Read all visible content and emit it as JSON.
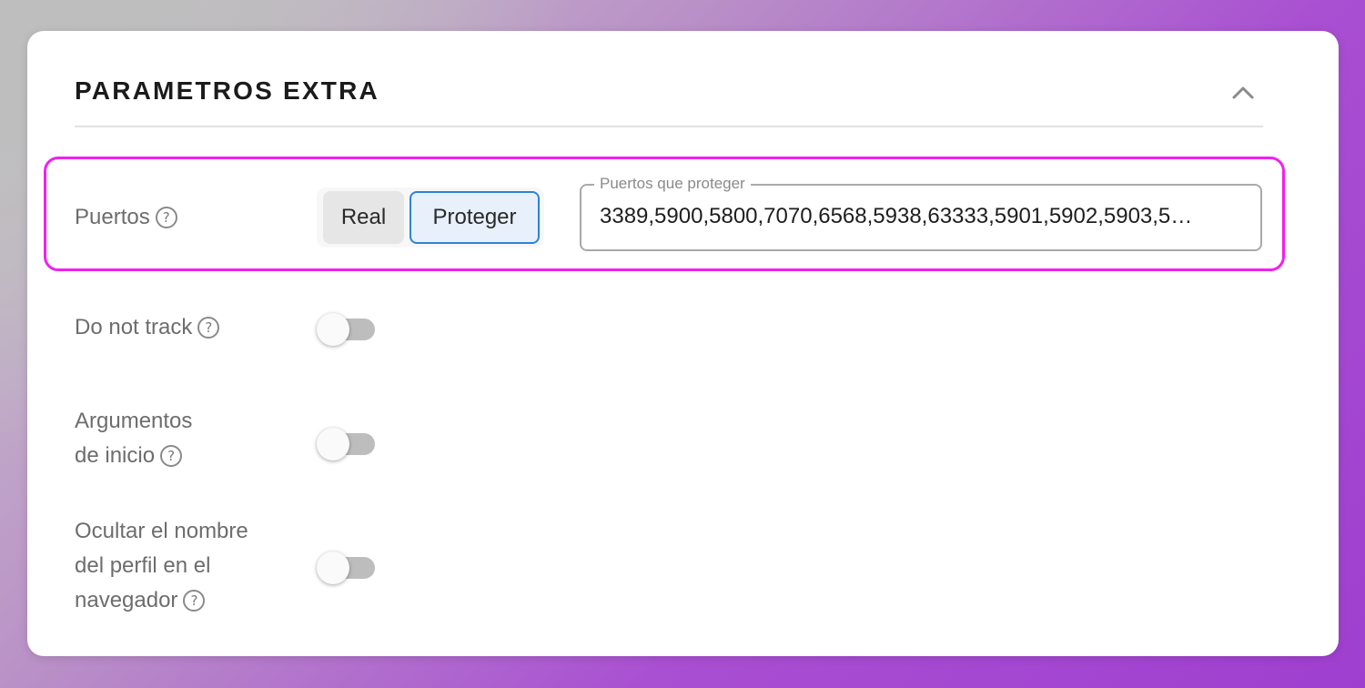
{
  "panel": {
    "title": "PARAMETROS EXTRA",
    "collapse_icon": "chevron-up-icon"
  },
  "ports": {
    "label": "Puertos",
    "help_icon": "?",
    "mode_options": [
      "Real",
      "Proteger"
    ],
    "selected_mode": "Proteger",
    "field_label": "Puertos que proteger",
    "field_value": "3389,5900,5800,7070,6568,5938,63333,5901,5902,5903,5…"
  },
  "settings": [
    {
      "label_lines": [
        "Do not track"
      ],
      "enabled": false
    },
    {
      "label_lines": [
        "Argumentos",
        "de inicio"
      ],
      "enabled": false
    },
    {
      "label_lines": [
        "Ocultar el nombre",
        "del perfil en el",
        "navegador"
      ],
      "enabled": false
    }
  ],
  "help_glyph": "?",
  "colors": {
    "highlight_border": "#f21ff0",
    "selected_accent": "#2c84d6",
    "selected_bg": "#e7f0fb"
  }
}
